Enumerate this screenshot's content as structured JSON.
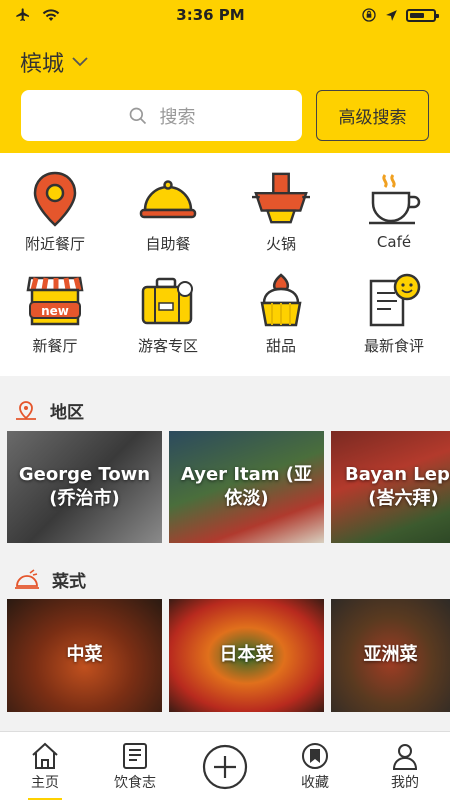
{
  "status": {
    "time": "3:36 PM"
  },
  "header": {
    "city": "槟城",
    "search_placeholder": "搜索",
    "advanced_search": "高级搜索"
  },
  "categories": [
    {
      "label": "附近餐厅",
      "icon": "location-pin-icon"
    },
    {
      "label": "自助餐",
      "icon": "cloche-icon"
    },
    {
      "label": "火锅",
      "icon": "hotpot-icon"
    },
    {
      "label": "Café",
      "icon": "coffee-cup-icon"
    },
    {
      "label": "新餐厅",
      "icon": "new-store-icon"
    },
    {
      "label": "游客专区",
      "icon": "suitcase-icon"
    },
    {
      "label": "甜品",
      "icon": "dessert-icon"
    },
    {
      "label": "最新食评",
      "icon": "review-icon"
    }
  ],
  "regions": {
    "title": "地区",
    "items": [
      {
        "line1": "George Town",
        "line2": "(乔治市)"
      },
      {
        "line1": "Ayer Itam (亚",
        "line2": "依淡)"
      },
      {
        "line1": "Bayan Lepa",
        "line2": "(峇六拜)"
      }
    ]
  },
  "cuisines": {
    "title": "菜式",
    "items": [
      {
        "label": "中菜"
      },
      {
        "label": "日本菜"
      },
      {
        "label": "亚洲菜"
      }
    ]
  },
  "tabs": [
    {
      "label": "主页",
      "icon": "home-icon"
    },
    {
      "label": "饮食志",
      "icon": "magazine-icon"
    },
    {
      "label": "",
      "icon": "plus-circle-icon"
    },
    {
      "label": "收藏",
      "icon": "bookmark-icon"
    },
    {
      "label": "我的",
      "icon": "profile-icon"
    }
  ],
  "colors": {
    "brand": "#fed100",
    "accent": "#e5562c"
  }
}
